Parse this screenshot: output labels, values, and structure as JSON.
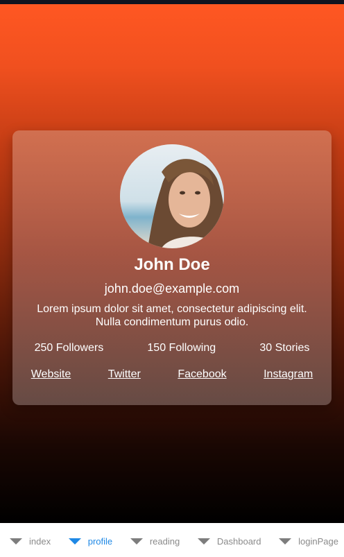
{
  "profile": {
    "name": "John Doe",
    "email": "john.doe@example.com",
    "bio": "Lorem ipsum dolor sit amet, consectetur adipiscing elit. Nulla condimentum purus odio.",
    "stats": {
      "followers": "250 Followers",
      "following": "150 Following",
      "stories": "30 Stories"
    },
    "links": {
      "website": "Website",
      "twitter": "Twitter",
      "facebook": "Facebook",
      "instagram": "Instagram"
    }
  },
  "tabs": [
    {
      "label": "index",
      "active": false
    },
    {
      "label": "profile",
      "active": true
    },
    {
      "label": "reading",
      "active": false
    },
    {
      "label": "Dashboard",
      "active": false
    },
    {
      "label": "loginPage",
      "active": false
    }
  ],
  "colors": {
    "accent": "#ff5722",
    "tab_active": "#1e88e5",
    "tab_inactive": "#8a8a8a"
  }
}
